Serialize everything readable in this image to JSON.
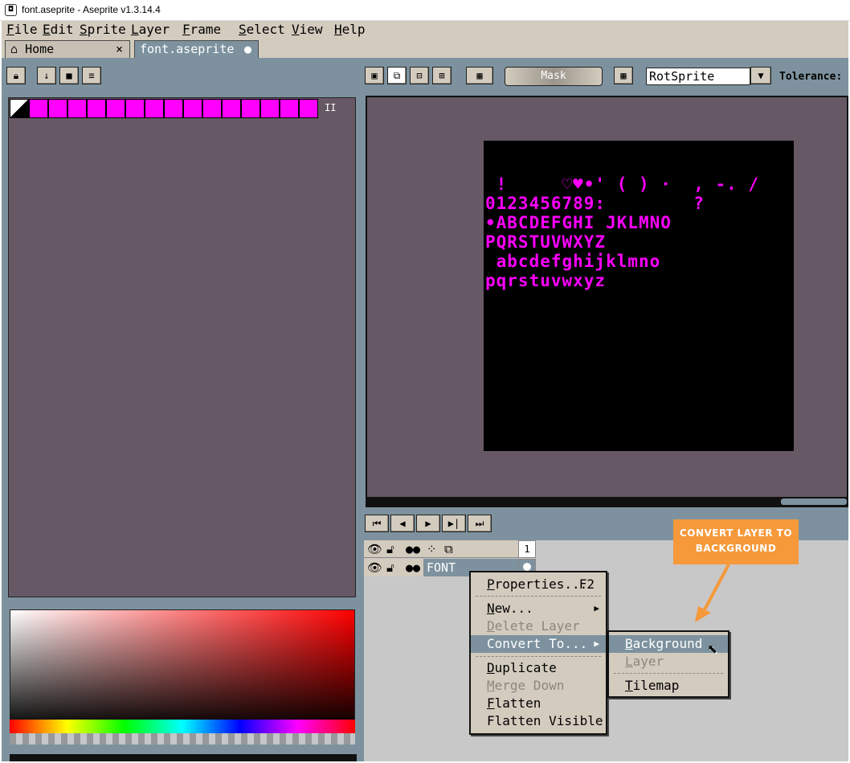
{
  "window": {
    "title": "font.aseprite - Aseprite v1.3.14.4",
    "icon": "aseprite-icon"
  },
  "menubar": [
    "File",
    "Edit",
    "Sprite",
    "Layer",
    "Frame",
    "Select",
    "View",
    "Help"
  ],
  "tabs": [
    {
      "label": "Home",
      "icon": "home-icon",
      "close": "×"
    },
    {
      "label": "font.aseprite",
      "modified": "●"
    }
  ],
  "toolbar": {
    "mask_label": "Mask",
    "rotation_algorithm": "RotSprite",
    "tolerance_label": "Tolerance:"
  },
  "palette": {
    "color": "#ff00ff",
    "swatch_count": 15,
    "menu_glyph": "II"
  },
  "sprite": {
    "background": "#000000",
    "glyph_color": "#ff00ff",
    "rows": [
      " !     ♡♥•' ( ) ·  , -. /",
      "0123456789:        ?",
      "•ABCDEFGHI JKLMNO",
      "PQRSTUVWXYZ",
      " abcdefghijklmno",
      "pqrstuvwxyz"
    ]
  },
  "timeline": {
    "frame_number": "1",
    "layer_name": "FONT"
  },
  "context_menu": {
    "items": [
      {
        "label": "Properties...",
        "shortcut": "F2",
        "enabled": true
      },
      {
        "label": "New...",
        "submenu": true,
        "enabled": true
      },
      {
        "label": "Delete Layer",
        "enabled": false
      },
      {
        "label": "Convert To...",
        "submenu": true,
        "enabled": true,
        "highlighted": true
      },
      {
        "label": "Duplicate",
        "enabled": true
      },
      {
        "label": "Merge Down",
        "enabled": false
      },
      {
        "label": "Flatten",
        "enabled": true
      },
      {
        "label": "Flatten Visible",
        "enabled": true
      }
    ]
  },
  "submenu": {
    "items": [
      {
        "label": "Background",
        "enabled": true,
        "highlighted": true
      },
      {
        "label": "Layer",
        "enabled": false
      },
      {
        "label": "Tilemap",
        "enabled": true
      }
    ]
  },
  "callout": {
    "line1": "CONVERT LAYER TO",
    "line2": "BACKGROUND",
    "color": "#f5993b"
  },
  "colors": {
    "accent": "#7d929e",
    "panel": "#d3cbbe",
    "editor_bg": "#665865"
  }
}
